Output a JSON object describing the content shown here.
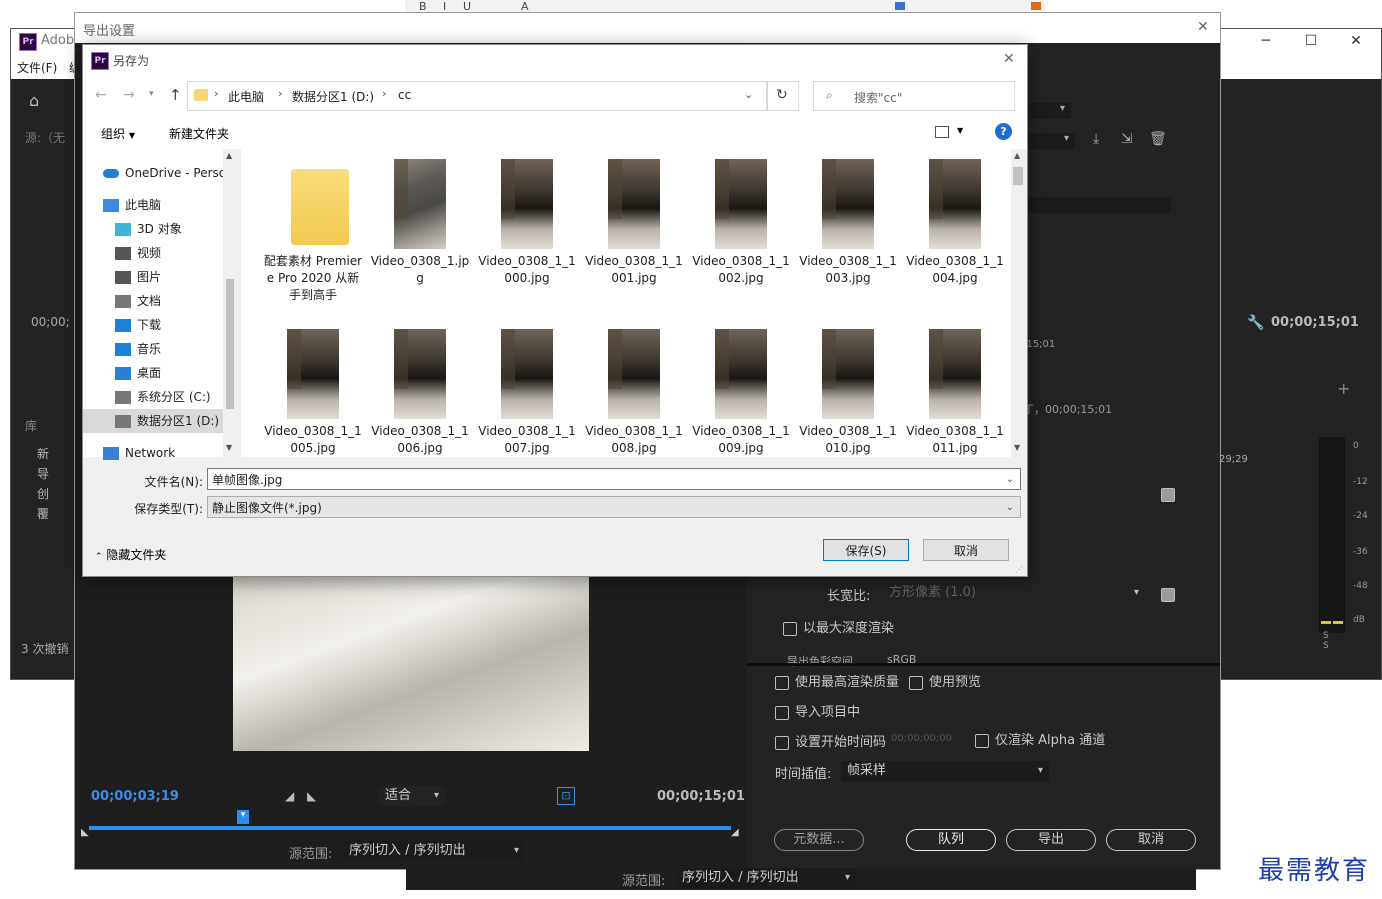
{
  "background_window": {
    "title": "Adob",
    "menu_file": "文件(F)",
    "menu_cut": "编",
    "source_label": "源:（无",
    "timecode_left": "00;00;",
    "library_label": "库",
    "undo_count": "3 次撤销",
    "list_items": [
      "新",
      "导",
      "创",
      "覆"
    ]
  },
  "export_dialog": {
    "title": "导出设置",
    "close_glyph": "✕",
    "right_time_end": "00;00;15;01",
    "right_time_small": ";15;01",
    "right_time_row": "丁，00;00;15;01",
    "meter_time": "29;29",
    "meter_scale": [
      "0",
      "-12",
      "-24",
      "-36",
      "-48",
      "dB"
    ],
    "meter_bottom": "S S",
    "aspect_label": "长宽比:",
    "aspect_value": "方形像素 (1.0)",
    "max_depth": "以最大深度渲染",
    "color_space_label": "导出色彩空间",
    "color_space_value": "sRGB",
    "use_max_quality": "使用最高渲染质量",
    "use_preview": "使用预览",
    "import_project": "导入项目中",
    "set_start_tc": "设置开始时间码",
    "start_tc_value": "00;00;00;00",
    "alpha_only": "仅渲染 Alpha 通道",
    "interp_label": "时间插值:",
    "interp_value": "帧采样",
    "btn_metadata": "元数据...",
    "btn_queue": "队列",
    "btn_export": "导出",
    "btn_cancel": "取消",
    "preview_time_current": "00;00;03;19",
    "preview_fit": "适合",
    "preview_time_end": "00;00;15;01",
    "source_range_label": "源范围:",
    "source_range_value": "序列切入 / 序列切出",
    "bottom_source_range_label": "源范围:",
    "bottom_source_range_value": "序列切入 / 序列切出"
  },
  "save_dialog": {
    "title": "另存为",
    "close_glyph": "✕",
    "breadcrumb": [
      "此电脑",
      "数据分区1 (D:)",
      "cc"
    ],
    "search_placeholder": "搜索\"cc\"",
    "organize": "组织",
    "new_folder": "新建文件夹",
    "help": "?",
    "nav": [
      {
        "label": "OneDrive - Perso",
        "icon": "cloud-icon"
      },
      {
        "label": "此电脑",
        "icon": "computer-icon"
      },
      {
        "label": "3D 对象",
        "icon": "cube-icon"
      },
      {
        "label": "视频",
        "icon": "video-icon"
      },
      {
        "label": "图片",
        "icon": "picture-icon"
      },
      {
        "label": "文档",
        "icon": "document-icon"
      },
      {
        "label": "下载",
        "icon": "download-icon"
      },
      {
        "label": "音乐",
        "icon": "music-icon"
      },
      {
        "label": "桌面",
        "icon": "desktop-icon"
      },
      {
        "label": "系统分区 (C:)",
        "icon": "drive-icon"
      },
      {
        "label": "数据分区1 (D:)",
        "icon": "drive-icon"
      },
      {
        "label": "Network",
        "icon": "network-icon"
      }
    ],
    "files": [
      {
        "name": "配套素材 Premiere Pro 2020 从新手到高手",
        "kind": "folder"
      },
      {
        "name": "Video_0308_1.jpg",
        "kind": "cat"
      },
      {
        "name": "Video_0308_1_1000.jpg",
        "kind": "frame"
      },
      {
        "name": "Video_0308_1_1001.jpg",
        "kind": "frame"
      },
      {
        "name": "Video_0308_1_1002.jpg",
        "kind": "frame"
      },
      {
        "name": "Video_0308_1_1003.jpg",
        "kind": "frame"
      },
      {
        "name": "Video_0308_1_1004.jpg",
        "kind": "frame"
      },
      {
        "name": "Video_0308_1_1005.jpg",
        "kind": "frame"
      },
      {
        "name": "Video_0308_1_1006.jpg",
        "kind": "frame"
      },
      {
        "name": "Video_0308_1_1007.jpg",
        "kind": "frame"
      },
      {
        "name": "Video_0308_1_1008.jpg",
        "kind": "frame"
      },
      {
        "name": "Video_0308_1_1009.jpg",
        "kind": "frame"
      },
      {
        "name": "Video_0308_1_1010.jpg",
        "kind": "frame"
      },
      {
        "name": "Video_0308_1_1011.jpg",
        "kind": "frame"
      }
    ],
    "filename_label": "文件名(N):",
    "filename_value": "单帧图像.jpg",
    "filetype_label": "保存类型(T):",
    "filetype_value": "静止图像文件(*.jpg)",
    "hide_folders": "隐藏文件夹",
    "btn_save": "保存(S)",
    "btn_cancel": "取消"
  },
  "watermark": "最需教育"
}
